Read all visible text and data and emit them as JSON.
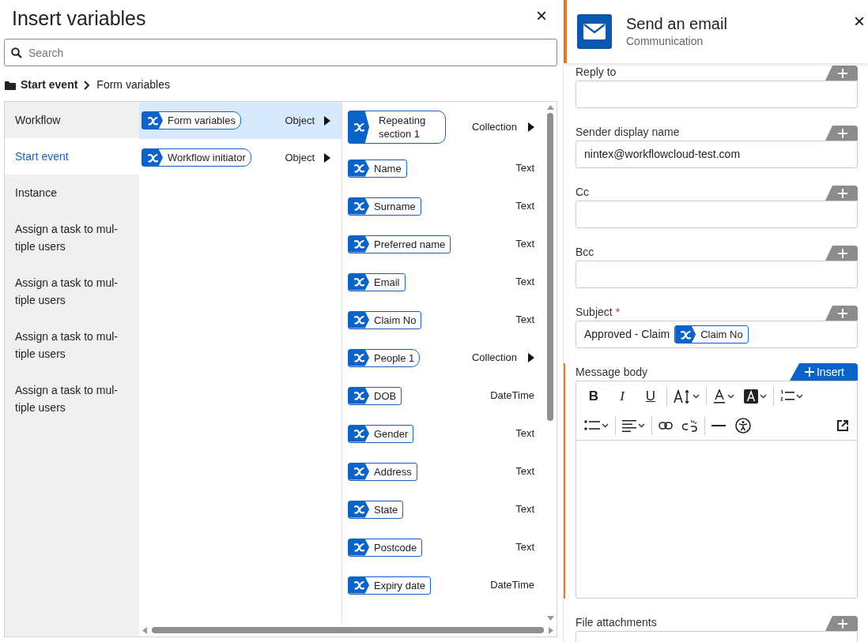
{
  "insert_panel": {
    "title": "Insert variables",
    "close": "×",
    "search": {
      "placeholder": "Search"
    },
    "breadcrumb": [
      {
        "label": "Start event",
        "kind": "folder"
      },
      {
        "label": "Form variables",
        "kind": "current"
      }
    ],
    "categories": [
      {
        "label": "Workflow",
        "selected": false
      },
      {
        "label": "Start event",
        "selected": true
      },
      {
        "label": "Instance",
        "selected": false
      },
      {
        "label": "Assign a task to mul-tiple users",
        "selected": false
      },
      {
        "label": "Assign a task to mul-tiple users",
        "selected": false
      },
      {
        "label": "Assign a task to mul-tiple users",
        "selected": false
      },
      {
        "label": "Assign a task to mul-tiple users",
        "selected": false
      }
    ],
    "variables": [
      {
        "name": "Form variables",
        "type": "Object",
        "selected": true,
        "expandable": true
      },
      {
        "name": "Workflow initiator",
        "type": "Object",
        "selected": false,
        "expandable": true
      }
    ],
    "fields": [
      {
        "name": "Repeating section 1",
        "type": "Collection",
        "expandable": true
      },
      {
        "name": "Name",
        "type": "Text",
        "expandable": false
      },
      {
        "name": "Surname",
        "type": "Text",
        "expandable": false
      },
      {
        "name": "Preferred name",
        "type": "Text",
        "expandable": false
      },
      {
        "name": "Email",
        "type": "Text",
        "expandable": false
      },
      {
        "name": "Claim No",
        "type": "Text",
        "expandable": false
      },
      {
        "name": "People 1",
        "type": "Collection",
        "expandable": true
      },
      {
        "name": "DOB",
        "type": "DateTime",
        "expandable": false
      },
      {
        "name": "Gender",
        "type": "Text",
        "expandable": false
      },
      {
        "name": "Address",
        "type": "Text",
        "expandable": false
      },
      {
        "name": "State",
        "type": "Text",
        "expandable": false
      },
      {
        "name": "Postcode",
        "type": "Text",
        "expandable": false
      },
      {
        "name": "Expiry date",
        "type": "DateTime",
        "expandable": false
      }
    ]
  },
  "email_panel": {
    "title": "Send an email",
    "subtitle": "Communication",
    "close": "×",
    "fields": [
      {
        "label": "Reply to",
        "kind": "input"
      },
      {
        "label": "Sender display name",
        "kind": "input",
        "value": "nintex@workflowcloud-test.com"
      },
      {
        "label": "Cc",
        "kind": "input"
      },
      {
        "label": "Bcc",
        "kind": "input"
      },
      {
        "label": "Subject",
        "kind": "input",
        "required_mark": "*",
        "value": "Approved - Claim",
        "token": "Claim No"
      },
      {
        "label": "Message body",
        "kind": "editor",
        "insert_label": "Insert",
        "toolbar": [
          [
            {
              "kind": "bold",
              "label": "B"
            },
            {
              "kind": "italic",
              "label": "I"
            },
            {
              "kind": "underline",
              "label": "U"
            },
            {
              "kind": "sep"
            },
            {
              "kind": "font-size"
            },
            {
              "kind": "sep"
            },
            {
              "kind": "font-color"
            },
            {
              "kind": "highlight"
            },
            {
              "kind": "sep"
            },
            {
              "kind": "numbered-list"
            }
          ],
          [
            {
              "kind": "bullet-list"
            },
            {
              "kind": "sep"
            },
            {
              "kind": "align"
            },
            {
              "kind": "sep"
            },
            {
              "kind": "link"
            },
            {
              "kind": "unlink"
            },
            {
              "kind": "sep"
            },
            {
              "kind": "rule"
            },
            {
              "kind": "accessibility"
            },
            {
              "kind": "spacer"
            },
            {
              "kind": "popout"
            }
          ]
        ]
      },
      {
        "label": "File attachments",
        "kind": "input"
      }
    ]
  }
}
